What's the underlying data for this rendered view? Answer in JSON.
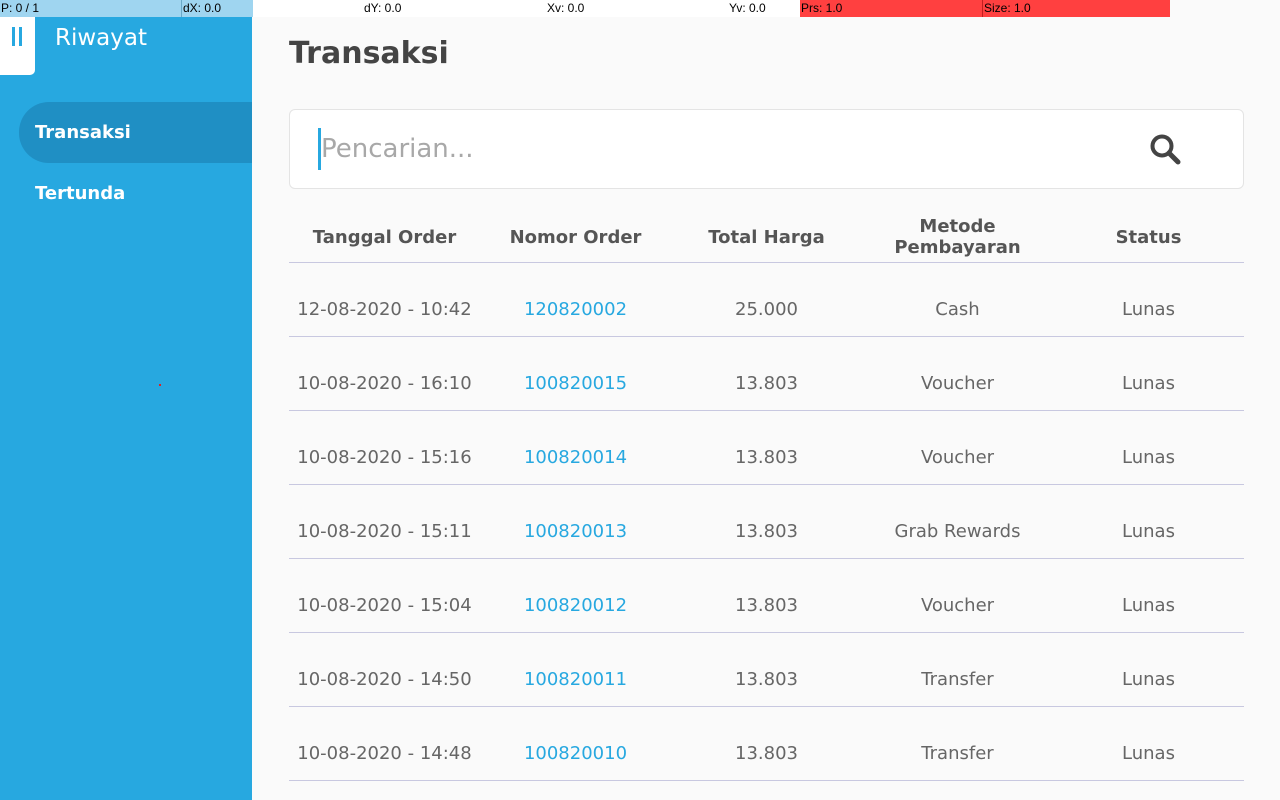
{
  "debug": {
    "p": "P: 0 / 1",
    "dx": "dX: 0.0",
    "dy": "dY: 0.0",
    "xv": "Xv: 0.0",
    "yv": "Yv: 0.0",
    "prs": "Prs: 1.0",
    "size": "Size: 1.0"
  },
  "sidebar": {
    "title": "Riwayat",
    "items": [
      {
        "label": "Transaksi",
        "active": true
      },
      {
        "label": "Tertunda",
        "active": false
      }
    ]
  },
  "main": {
    "title": "Transaksi",
    "search": {
      "placeholder": "Pencarian...",
      "value": ""
    },
    "table": {
      "columns": [
        "Tanggal Order",
        "Nomor Order",
        "Total Harga",
        "Metode Pembayaran",
        "Status"
      ],
      "rows": [
        [
          "12-08-2020 - 10:42",
          "120820002",
          "25.000",
          "Cash",
          "Lunas"
        ],
        [
          "10-08-2020 - 16:10",
          "100820015",
          "13.803",
          "Voucher",
          "Lunas"
        ],
        [
          "10-08-2020 - 15:16",
          "100820014",
          "13.803",
          "Voucher",
          "Lunas"
        ],
        [
          "10-08-2020 - 15:11",
          "100820013",
          "13.803",
          "Grab Rewards",
          "Lunas"
        ],
        [
          "10-08-2020 - 15:04",
          "100820012",
          "13.803",
          "Voucher",
          "Lunas"
        ],
        [
          "10-08-2020 - 14:50",
          "100820011",
          "13.803",
          "Transfer",
          "Lunas"
        ],
        [
          "10-08-2020 - 14:48",
          "100820010",
          "13.803",
          "Transfer",
          "Lunas"
        ]
      ]
    }
  },
  "colors": {
    "accent": "#27a8e0",
    "accent_dark": "#1f8fc4",
    "debug_red": "#ff4040",
    "debug_blue": "#9fd5f0"
  },
  "icons": {
    "menu": "menu-icon",
    "search": "search-icon"
  }
}
